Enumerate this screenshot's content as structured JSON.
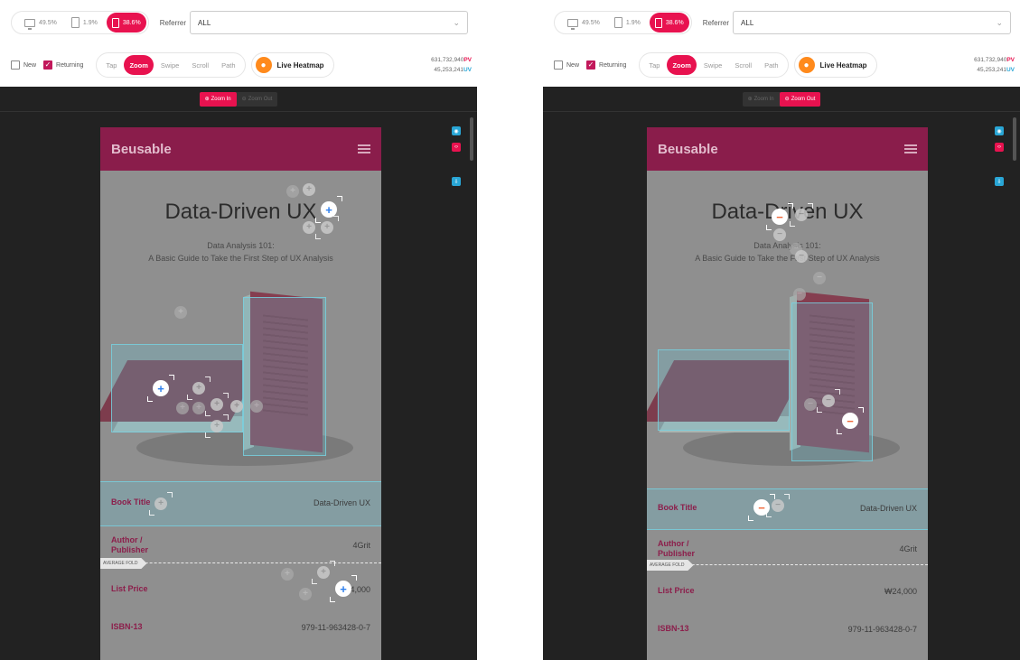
{
  "toolbar": {
    "devices": [
      {
        "name": "desktop",
        "value": "49.5%"
      },
      {
        "name": "tablet",
        "value": "1.9%"
      },
      {
        "name": "mobile",
        "value": "38.6%"
      }
    ],
    "referrer_label": "Referrer",
    "referrer_value": "ALL",
    "filters": [
      {
        "label": "New",
        "checked": false
      },
      {
        "label": "Returning",
        "checked": true
      }
    ],
    "modes": [
      "Tap",
      "Zoom",
      "Swipe",
      "Scroll",
      "Path"
    ],
    "active_mode": "Zoom",
    "live_heatmap_label": "Live Heatmap",
    "pv_value": "631,732,940",
    "pv_label": "PV",
    "uv_value": "45,253,241",
    "uv_label": "UV"
  },
  "zoom_toolbar": {
    "zoom_in_label": "Zoom In",
    "zoom_out_label": "Zoom Out",
    "left_active": "Zoom In",
    "right_active": "Zoom Out"
  },
  "phone": {
    "logo": "Beusable",
    "headline": "Data-Driven UX",
    "subtitle_line1": "Data Analysis 101:",
    "subtitle_line2": "A Basic Guide to Take the First Step of UX Analysis",
    "rows": [
      {
        "label": "Book Title",
        "value": "Data-Driven UX"
      },
      {
        "label": "Author / Publisher",
        "value": "4Grit"
      },
      {
        "label": "List Price",
        "value": "₩24,000"
      },
      {
        "label": "ISBN-13",
        "value": "979-11-963428-0-7"
      }
    ],
    "average_fold_label": "AVERAGE FOLD"
  },
  "colors": {
    "accent": "#e8124f",
    "header": "#8a1d4b",
    "zoom_in_marker": "#2f80ed",
    "zoom_out_marker": "#f0693b",
    "highlight": "#64c8dc"
  },
  "icons": [
    "desktop-icon",
    "tablet-icon",
    "mobile-icon",
    "checkbox-icon",
    "live-heatmap-icon",
    "zoom-in-icon",
    "zoom-out-icon",
    "menu-icon",
    "eye-icon",
    "code-icon",
    "download-icon",
    "chevron-down-icon"
  ]
}
